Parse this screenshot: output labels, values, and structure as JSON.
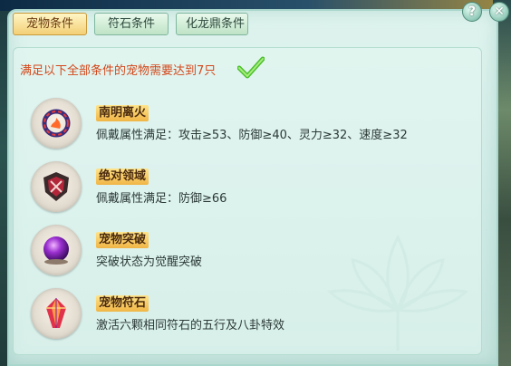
{
  "tabs": [
    {
      "label": "宠物条件",
      "active": true
    },
    {
      "label": "符石条件",
      "active": false
    },
    {
      "label": "化龙鼎条件",
      "active": false
    }
  ],
  "summary": "满足以下全部条件的宠物需要达到7只",
  "conditions": [
    {
      "title": "南明离火",
      "desc": "佩戴属性满足：攻击≥53、防御≥40、灵力≥32、速度≥32",
      "icon": "fire-ring-icon"
    },
    {
      "title": "绝对领域",
      "desc": "佩戴属性满足：防御≥66",
      "icon": "shield-crest-icon"
    },
    {
      "title": "宠物突破",
      "desc": "突破状态为觉醒突破",
      "icon": "purple-orb-icon"
    },
    {
      "title": "宠物符石",
      "desc": "激活六颗相同符石的五行及八卦特效",
      "icon": "crystal-icon"
    }
  ],
  "buttons": {
    "help": "?",
    "close": "✕"
  },
  "colors": {
    "summary": "#d3471a",
    "accent": "#f3cf76",
    "panel": "#dff3ee"
  }
}
